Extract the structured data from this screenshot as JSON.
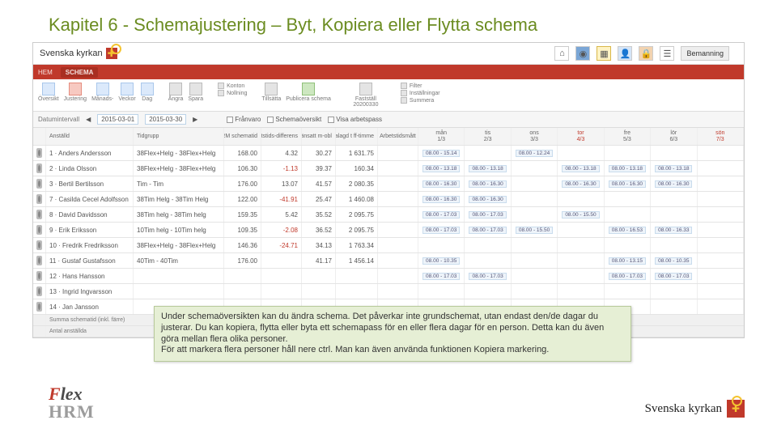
{
  "slide_title": "Kapitel 6 - Schemajustering – Byt, Kopiera eller Flytta schema",
  "brand": {
    "name": "Svenska kyrkan",
    "staff_link": "Bemanning"
  },
  "modules": [
    "HEM",
    "SCHEMA"
  ],
  "ribbon": {
    "g1": [
      "Översikt",
      "Justering",
      "Månads-",
      "Veckor",
      "Dag"
    ],
    "g2": [
      "Ångra",
      "Spara"
    ],
    "g3": [
      "Konton",
      "Nollning"
    ],
    "g4": [
      "Tillsätta",
      "Publicera schema"
    ],
    "g5": "Fastställ 20200330",
    "filters": [
      "Filter",
      "Inställningar",
      "Summera"
    ]
  },
  "date_strip": {
    "label": "Datumintervall",
    "from": "2015-03-01",
    "to": "2015-03-30",
    "checks": [
      "Frånvaro",
      "Schemaöversikt",
      "Visa arbetspass"
    ]
  },
  "columns": {
    "emp": "Anställd",
    "grp": "Tidgrupp",
    "sch": "HRM schematid",
    "diff": "Arbetstids-differens",
    "pct": "Flänsatt m-obl",
    "sum": "Schemalagd t ff-timme",
    "ahd": "Arbetstidsmått"
  },
  "days": [
    {
      "dow": "mån",
      "dno": "1/3"
    },
    {
      "dow": "tis",
      "dno": "2/3"
    },
    {
      "dow": "ons",
      "dno": "3/3"
    },
    {
      "dow": "tor",
      "dno": "4/3",
      "wknd": true
    },
    {
      "dow": "fre",
      "dno": "5/3"
    },
    {
      "dow": "lör",
      "dno": "6/3"
    },
    {
      "dow": "sön",
      "dno": "7/3",
      "wknd": true
    }
  ],
  "rows": [
    {
      "n": "1 · Anders Andersson",
      "g": "38Flex+Helg - 38Flex+Helg",
      "sch": "168.00",
      "diff": "4.32",
      "pct": "30.27",
      "sum": "1 631.75",
      "cells": [
        "08.00 - 15.14",
        "",
        "08.00 - 12.24",
        "",
        "",
        "",
        ""
      ]
    },
    {
      "n": "2 · Linda Olsson",
      "g": "38Flex+Helg - 38Flex+Helg",
      "sch": "106.30",
      "diff": "-1.13",
      "neg": true,
      "pct": "39.37",
      "sum": "160.34",
      "cells": [
        "08.00 - 13.18",
        "08.00 - 13.18",
        "",
        "08.00 - 13.18",
        "08.00 - 13.18",
        "08.00 - 13.18",
        ""
      ]
    },
    {
      "n": "3 · Bertil Bertilsson",
      "g": "Tim - Tim",
      "sch": "176.00",
      "diff": "13.07",
      "pct": "41.57",
      "sum": "2 080.35",
      "cells": [
        "08.00 - 16.30",
        "08.00 - 16.30",
        "",
        "08.00 - 16.30",
        "08.00 - 16.30",
        "08.00 - 16.30",
        ""
      ]
    },
    {
      "n": "7 · Casilda Cecel Adolfsson",
      "g": "38Tim Helg - 38Tim Helg",
      "sch": "122.00",
      "diff": "-41.91",
      "neg": true,
      "pct": "25.47",
      "sum": "1 460.08",
      "cells": [
        "08.00 - 16.30",
        "08.00 - 16.30",
        "",
        "",
        "",
        "",
        ""
      ]
    },
    {
      "n": "8 · David Davidsson",
      "g": "38Tim helg - 38Tim helg",
      "sch": "159.35",
      "diff": "5.42",
      "pct": "35.52",
      "sum": "2 095.75",
      "cells": [
        "08.00 - 17.03",
        "08.00 - 17.03",
        "",
        "08.00 - 15.50",
        "",
        "",
        ""
      ]
    },
    {
      "n": "9 · Erik Eriksson",
      "g": "10Tim helg - 10Tim helg",
      "sch": "109.35",
      "diff": "-2.08",
      "neg": true,
      "pct": "36.52",
      "sum": "2 095.75",
      "cells": [
        "08.00 - 17.03",
        "08.00 - 17.03",
        "08.00 - 15.50",
        "",
        "08.00 - 16.53",
        "08.00 - 16.33",
        ""
      ]
    },
    {
      "n": "10 · Fredrik Fredriksson",
      "g": "38Flex+Helg - 38Flex+Helg",
      "sch": "146.36",
      "diff": "-24.71",
      "neg": true,
      "pct": "34.13",
      "sum": "1 763.34",
      "cells": [
        "",
        "",
        "",
        "",
        "",
        "",
        ""
      ]
    },
    {
      "n": "11 · Gustaf Gustafsson",
      "g": "40Tim - 40Tim",
      "sch": "176.00",
      "diff": "",
      "pct": "41.17",
      "sum": "1 456.14",
      "cells": [
        "08.00 - 10.35",
        "",
        "",
        "",
        "08.00 - 13.15",
        "08.00 - 10.35",
        ""
      ]
    },
    {
      "n": "12 · Hans Hansson",
      "g": "",
      "sch": "",
      "diff": "",
      "pct": "",
      "sum": "",
      "cells": [
        "08.00 - 17.03",
        "08.00 - 17.03",
        "",
        "",
        "08.00 - 17.03",
        "08.00 - 17.03",
        ""
      ]
    },
    {
      "n": "13 · Ingrid Ingvarsson",
      "g": "",
      "sch": "",
      "diff": "",
      "pct": "",
      "sum": "",
      "cells": [
        "",
        "",
        "",
        "",
        "",
        "",
        ""
      ]
    },
    {
      "n": "14 · Jan Jansson",
      "g": "",
      "sch": "",
      "diff": "",
      "pct": "",
      "sum": "",
      "cells": [
        "",
        "",
        "",
        "",
        "",
        "",
        ""
      ]
    }
  ],
  "footer_rows": [
    "Summa schematid (inkl. färre)",
    "Antal anställda"
  ],
  "callout": "Under schemaöversikten kan du ändra schema. Det påverkar inte grundschemat, utan endast den/de dagar du justerar. Du kan kopiera, flytta eller byta ett schemapass för en eller flera dagar för en person. Detta kan du även göra mellan flera olika personer.\nFör att markera flera personer håll nere ctrl. Man kan även använda funktionen Kopiera markering.",
  "logos": {
    "flex": "Flex",
    "hrm": "HRM",
    "sk": "Svenska kyrkan"
  }
}
